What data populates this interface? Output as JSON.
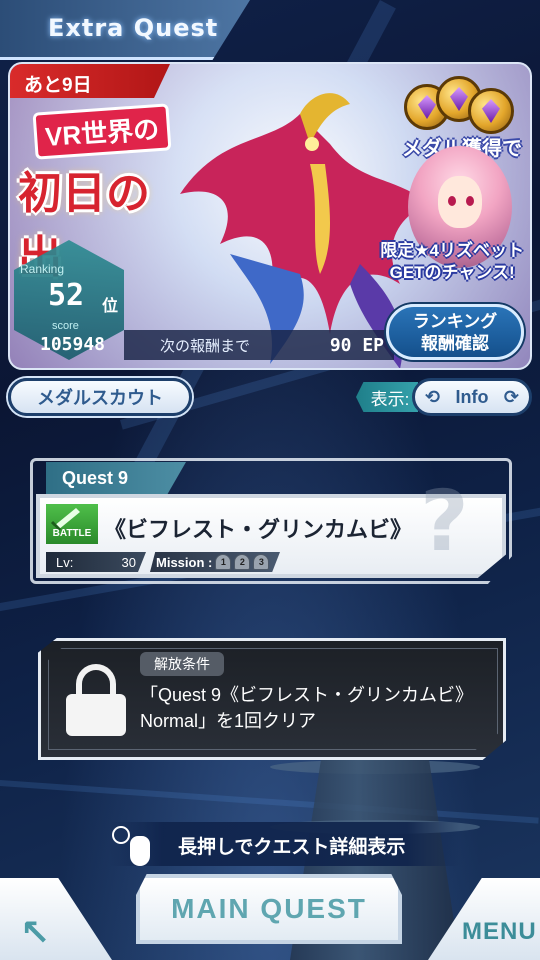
{
  "header": {
    "title": "Extra Quest"
  },
  "banner": {
    "days_left": "あと9日",
    "event_title_line1": "VR世界の",
    "event_title_line2": "初日の出",
    "medal_caption": "メダル獲得で",
    "limited_line1": "限定★4リズベット",
    "limited_line2": "GETのチャンス!",
    "ranking_label": "Ranking",
    "ranking_value": "52",
    "ranking_unit": "位",
    "score_label": "score",
    "score_value": "105948",
    "next_reward_label": "次の報酬まで",
    "next_reward_value": "90 EP",
    "reward_button_line1": "ランキング",
    "reward_button_line2": "報酬確認"
  },
  "controls": {
    "medal_scout": "メダルスカウト",
    "display_label": "表示:",
    "info_button": "Info"
  },
  "quest": {
    "tab_label": "Quest 9",
    "type_label": "BATTLE",
    "name": "《ビフレスト・グリンカムビ》",
    "lv_label": "Lv:",
    "lv_value": "30",
    "mission_label": "Mission :",
    "missions": [
      "1",
      "2",
      "3"
    ]
  },
  "locked": {
    "badge": "解放条件",
    "condition": "「Quest 9《ビフレスト・グリンカムビ》Normal」を1回クリア"
  },
  "hint": {
    "text": "長押しでクエスト詳細表示"
  },
  "nav": {
    "main_quest": "MAIN QUEST",
    "menu": "MENU"
  }
}
